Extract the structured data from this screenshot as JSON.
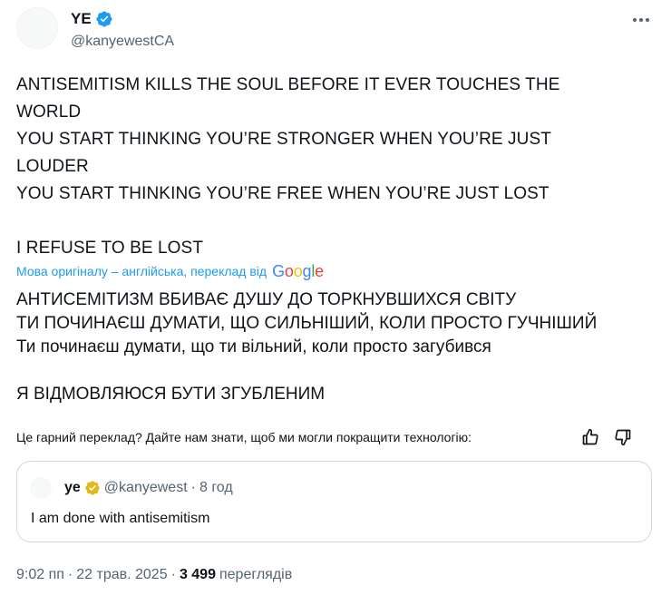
{
  "author": {
    "name": "YE",
    "handle": "@kanyewestCA"
  },
  "tweet_lines": [
    "ANTISEMITISM KILLS THE SOUL BEFORE IT EVER TOUCHES THE",
    "WORLD",
    "YOU START THINKING YOU’RE STRONGER WHEN YOU’RE JUST",
    "LOUDER",
    "YOU START THINKING YOU’RE FREE WHEN YOU’RE JUST LOST",
    "I REFUSE TO BE LOST"
  ],
  "translation": {
    "note": "Мова оригіналу – англійська, переклад від",
    "provider_letters": [
      "G",
      "o",
      "o",
      "g",
      "l",
      "e"
    ],
    "lines": [
      "АНТИСЕМІТИЗМ ВБИВАЄ ДУШУ ДО ТОРКНУВШИХСЯ СВІТУ",
      "ТИ ПОЧИНАЄШ ДУМАТИ, ЩО СИЛЬНІШИЙ, КОЛИ ПРОСТО ГУЧНІШИЙ",
      "Ти починаєш думати, що ти вільний, коли просто загубився",
      "Я ВІДМОВЛЯЮСЯ БУТИ ЗГУБЛЕНИМ"
    ],
    "feedback": "Це гарний переклад? Дайте нам знати, щоб ми могли покращити технологію:"
  },
  "quote": {
    "name": "ye",
    "handle": "@kanyewest",
    "separator": "·",
    "time": "8 год",
    "text": "I am done with antisemitism"
  },
  "footer": {
    "time": "9:02 пп",
    "separator": "·",
    "date": "22 трав. 2025",
    "views_count": "3 499",
    "views_label": "переглядів"
  },
  "icons": {
    "verified": "verified-badge-icon",
    "verified_gold": "gold-verified-badge-icon",
    "more": "more-options-icon",
    "thumbs_up": "thumbs-up-icon",
    "thumbs_down": "thumbs-down-icon"
  },
  "colors": {
    "link": "#1d9bf0",
    "verified_blue": "#1d9bf0",
    "verified_gold": "#e2b719",
    "secondary_text": "#536471",
    "border": "#cfd9de"
  }
}
